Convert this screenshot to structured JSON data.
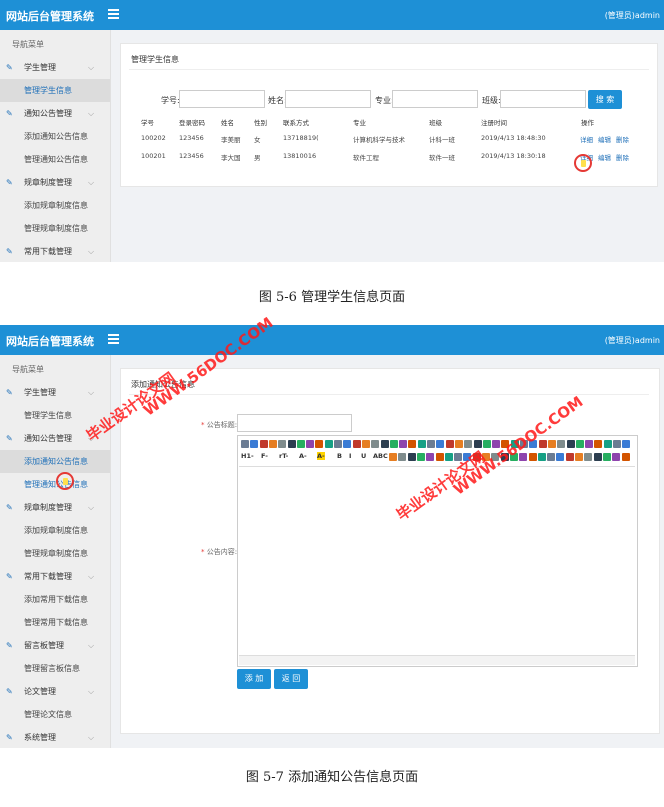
{
  "app": {
    "title": "网站后台管理系统",
    "user": "(管理员)admin"
  },
  "nav_title": "导航菜单",
  "shot1": {
    "sidebar": [
      {
        "type": "group",
        "label": "学生管理",
        "icon": "edit-icon"
      },
      {
        "type": "sub",
        "label": "管理学生信息",
        "state": "active"
      },
      {
        "type": "group",
        "label": "通知公告管理",
        "icon": "edit-icon"
      },
      {
        "type": "sub",
        "label": "添加通知公告信息"
      },
      {
        "type": "sub",
        "label": "管理通知公告信息"
      },
      {
        "type": "group",
        "label": "规章制度管理",
        "icon": "edit-icon"
      },
      {
        "type": "sub",
        "label": "添加规章制度信息"
      },
      {
        "type": "sub",
        "label": "管理规章制度信息"
      },
      {
        "type": "group",
        "label": "常用下载管理",
        "icon": "edit-icon"
      }
    ],
    "panel_title": "管理学生信息",
    "search": {
      "labels": [
        "学号:",
        "姓名:",
        "专业:",
        "班级:"
      ],
      "button": "搜 索"
    },
    "table": {
      "headers": [
        "学号",
        "登录密码",
        "姓名",
        "性别",
        "联系方式",
        "专业",
        "班级",
        "注册时间",
        "操作"
      ],
      "rows": [
        [
          "100202",
          "123456",
          "李美丽",
          "女",
          "13718819(",
          "计算机科学与技术",
          "计科一班",
          "2019/4/13 18:48:30"
        ],
        [
          "100201",
          "123456",
          "李大国",
          "男",
          "13810016",
          "软件工程",
          "软件一班",
          "2019/4/13 18:30:18"
        ]
      ],
      "actions": [
        "详细",
        "编辑",
        "删除"
      ]
    },
    "caption": "图 5-6 管理学生信息页面"
  },
  "shot2": {
    "sidebar": [
      {
        "type": "group",
        "label": "学生管理",
        "icon": "edit-icon"
      },
      {
        "type": "sub",
        "label": "管理学生信息"
      },
      {
        "type": "group",
        "label": "通知公告管理",
        "icon": "edit-icon"
      },
      {
        "type": "sub",
        "label": "添加通知公告信息",
        "state": "active"
      },
      {
        "type": "sub",
        "label": "管理通知公告信息",
        "state": "link"
      },
      {
        "type": "group",
        "label": "规章制度管理",
        "icon": "edit-icon"
      },
      {
        "type": "sub",
        "label": "添加规章制度信息"
      },
      {
        "type": "sub",
        "label": "管理规章制度信息"
      },
      {
        "type": "group",
        "label": "常用下载管理",
        "icon": "edit-icon"
      },
      {
        "type": "sub",
        "label": "添加常用下载信息"
      },
      {
        "type": "sub",
        "label": "管理常用下载信息"
      },
      {
        "type": "group",
        "label": "留言板管理",
        "icon": "edit-icon"
      },
      {
        "type": "sub",
        "label": "管理留言板信息"
      },
      {
        "type": "group",
        "label": "论文管理",
        "icon": "edit-icon"
      },
      {
        "type": "sub",
        "label": "管理论文信息"
      },
      {
        "type": "group",
        "label": "系统管理",
        "icon": "edit-icon"
      }
    ],
    "panel_title": "添加通知公告信息",
    "form": {
      "title_label": "公告标题:",
      "content_label": "公告内容:",
      "editor_row2": [
        "H1-",
        "F-",
        "rT-",
        "A-",
        "A-",
        "B",
        "I",
        "U",
        "ABC"
      ],
      "add_button": "添 加",
      "back_button": "返 回"
    },
    "caption": "图 5-7 添加通知公告信息页面"
  },
  "watermark": {
    "site": "WWW.56DOC.COM",
    "cn": "毕业设计论文网"
  },
  "colors": {
    "header": "#1e90d6",
    "link": "#1e6fb8",
    "watermark": "#ff1a1a",
    "cursor_ring": "#e53935"
  }
}
